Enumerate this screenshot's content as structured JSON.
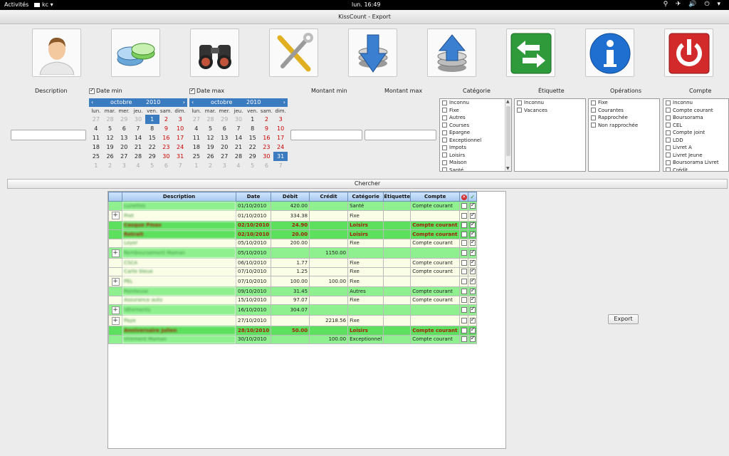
{
  "topbar": {
    "activities": "Activités",
    "app": "kc ▾",
    "clock": "lun. 16:49",
    "status_icons": "⚲ ✈ 🔊 ⏻ ▾"
  },
  "window": {
    "title": "KissCount - Export"
  },
  "toolbar": [
    "user-icon",
    "accounts-icon",
    "search-icon",
    "preferences-icon",
    "import-icon",
    "export-icon",
    "transfer-icon",
    "info-icon",
    "quit-icon"
  ],
  "filters": {
    "description_label": "Description",
    "date_min_label": "Date min",
    "date_max_label": "Date max",
    "montant_min_label": "Montant min",
    "montant_max_label": "Montant max",
    "categorie_label": "Catégorie",
    "etiquette_label": "Étiquette",
    "operations_label": "Opérations",
    "compte_label": "Compte",
    "description_value": "",
    "montant_min_value": "",
    "montant_max_value": ""
  },
  "calendar_min": {
    "month": "octobre",
    "year": "2010",
    "dow": [
      "lun.",
      "mar.",
      "mer.",
      "jeu.",
      "ven.",
      "sam.",
      "dim."
    ],
    "weeks": [
      [
        "27",
        "28",
        "29",
        "30",
        "1",
        "2",
        "3"
      ],
      [
        "4",
        "5",
        "6",
        "7",
        "8",
        "9",
        "10"
      ],
      [
        "11",
        "12",
        "13",
        "14",
        "15",
        "16",
        "17"
      ],
      [
        "18",
        "19",
        "20",
        "21",
        "22",
        "23",
        "24"
      ],
      [
        "25",
        "26",
        "27",
        "28",
        "29",
        "30",
        "31"
      ],
      [
        "1",
        "2",
        "3",
        "4",
        "5",
        "6",
        "7"
      ]
    ],
    "selected": "1"
  },
  "calendar_max": {
    "month": "octobre",
    "year": "2010",
    "dow": [
      "lun.",
      "mar.",
      "mer.",
      "jeu.",
      "ven.",
      "sam.",
      "dim."
    ],
    "weeks": [
      [
        "27",
        "28",
        "29",
        "30",
        "1",
        "2",
        "3"
      ],
      [
        "4",
        "5",
        "6",
        "7",
        "8",
        "9",
        "10"
      ],
      [
        "11",
        "12",
        "13",
        "14",
        "15",
        "16",
        "17"
      ],
      [
        "18",
        "19",
        "20",
        "21",
        "22",
        "23",
        "24"
      ],
      [
        "25",
        "26",
        "27",
        "28",
        "29",
        "30",
        "31"
      ],
      [
        "1",
        "2",
        "3",
        "4",
        "5",
        "6",
        "7"
      ]
    ],
    "selected": "31"
  },
  "categories": [
    "Inconnu",
    "Fixe",
    "Autres",
    "Courses",
    "Epargne",
    "Exceptionnel",
    "Impots",
    "Loisirs",
    "Maison",
    "Santé"
  ],
  "etiquettes": [
    "Inconnu",
    "Vacances"
  ],
  "operations": [
    "Fixe",
    "Courantes",
    "Rapprochée",
    "Non rapprochée"
  ],
  "comptes": [
    "Inconnu",
    "Compte courant",
    "Boursorama",
    "CEL",
    "Compte joint",
    "LDD",
    "Livret A",
    "Livret Jeune",
    "Boursorama Livret",
    "Crédit"
  ],
  "search_button": "Chercher",
  "export_button": "Export",
  "grid": {
    "columns": [
      "",
      "Description",
      "Date",
      "Débit",
      "Crédit",
      "Catégorie",
      "Étiquette",
      "Compte"
    ],
    "rows": [
      {
        "style": "g1",
        "plus": "",
        "desc": "Lunettes",
        "date": "01/10/2010",
        "debit": "420.00",
        "credit": "",
        "cat": "Santé",
        "etq": "",
        "compte": "Compte courant",
        "c2": "✓"
      },
      {
        "style": "pl tall",
        "plus": "+",
        "desc": "Pret",
        "date": "01/10/2010",
        "debit": "334.38",
        "credit": "",
        "cat": "Fixe",
        "etq": "",
        "compte": "",
        "c2": "✓"
      },
      {
        "style": "g2 bold",
        "plus": "",
        "desc": "Casque Pmax",
        "date": "02/10/2010",
        "debit": "24.90",
        "credit": "",
        "cat": "Loisirs",
        "etq": "",
        "compte": "Compte courant",
        "c2": "✓"
      },
      {
        "style": "g2 bold",
        "plus": "",
        "desc": "Retrait",
        "date": "02/10/2010",
        "debit": "20.00",
        "credit": "",
        "cat": "Loisirs",
        "etq": "",
        "compte": "Compte courant",
        "c2": "✓"
      },
      {
        "style": "pl",
        "plus": "",
        "desc": "Loyer",
        "date": "05/10/2010",
        "debit": "200.00",
        "credit": "",
        "cat": "Fixe",
        "etq": "",
        "compte": "Compte courant",
        "c2": "✓"
      },
      {
        "style": "g1 tall",
        "plus": "+",
        "desc": "Remboursement Maman",
        "date": "05/10/2010",
        "debit": "",
        "credit": "1150.00",
        "cat": "",
        "etq": "",
        "compte": "",
        "c2": "✓"
      },
      {
        "style": "pl",
        "plus": "",
        "desc": "CSCA",
        "date": "06/10/2010",
        "debit": "1.77",
        "credit": "",
        "cat": "Fixe",
        "etq": "",
        "compte": "Compte courant",
        "c2": "✓"
      },
      {
        "style": "pl",
        "plus": "",
        "desc": "Carte bleue",
        "date": "07/10/2010",
        "debit": "1.25",
        "credit": "",
        "cat": "Fixe",
        "etq": "",
        "compte": "Compte courant",
        "c2": "✓"
      },
      {
        "style": "pl tall",
        "plus": "+",
        "desc": "PEL",
        "date": "07/10/2010",
        "debit": "100.00",
        "credit": "100.00",
        "cat": "Fixe",
        "etq": "",
        "compte": "",
        "c2": "✓"
      },
      {
        "style": "g1",
        "plus": "",
        "desc": "Pointeuse",
        "date": "09/10/2010",
        "debit": "31.45",
        "credit": "",
        "cat": "Autres",
        "etq": "",
        "compte": "Compte courant",
        "c2": "✓"
      },
      {
        "style": "pl",
        "plus": "",
        "desc": "Assurance auto",
        "date": "15/10/2010",
        "debit": "97.07",
        "credit": "",
        "cat": "Fixe",
        "etq": "",
        "compte": "Compte courant",
        "c2": "✓"
      },
      {
        "style": "g1 tall",
        "plus": "+",
        "desc": "Vêtements",
        "date": "16/10/2010",
        "debit": "304.07",
        "credit": "",
        "cat": "",
        "etq": "",
        "compte": "",
        "c2": "✓"
      },
      {
        "style": "pl tall",
        "plus": "+",
        "desc": "Paye",
        "date": "27/10/2010",
        "debit": "",
        "credit": "2218.56",
        "cat": "Fixe",
        "etq": "",
        "compte": "",
        "c2": "✓"
      },
      {
        "style": "g2 bold",
        "plus": "",
        "desc": "Anniversaire Julien",
        "date": "28/10/2010",
        "debit": "50.00",
        "credit": "",
        "cat": "Loisirs",
        "etq": "",
        "compte": "Compte courant",
        "c2": "✓"
      },
      {
        "style": "g1",
        "plus": "",
        "desc": "Virement Maman",
        "date": "30/10/2010",
        "debit": "",
        "credit": "100.00",
        "cat": "Exceptionnel",
        "etq": "",
        "compte": "Compte courant",
        "c2": "✓"
      }
    ]
  }
}
